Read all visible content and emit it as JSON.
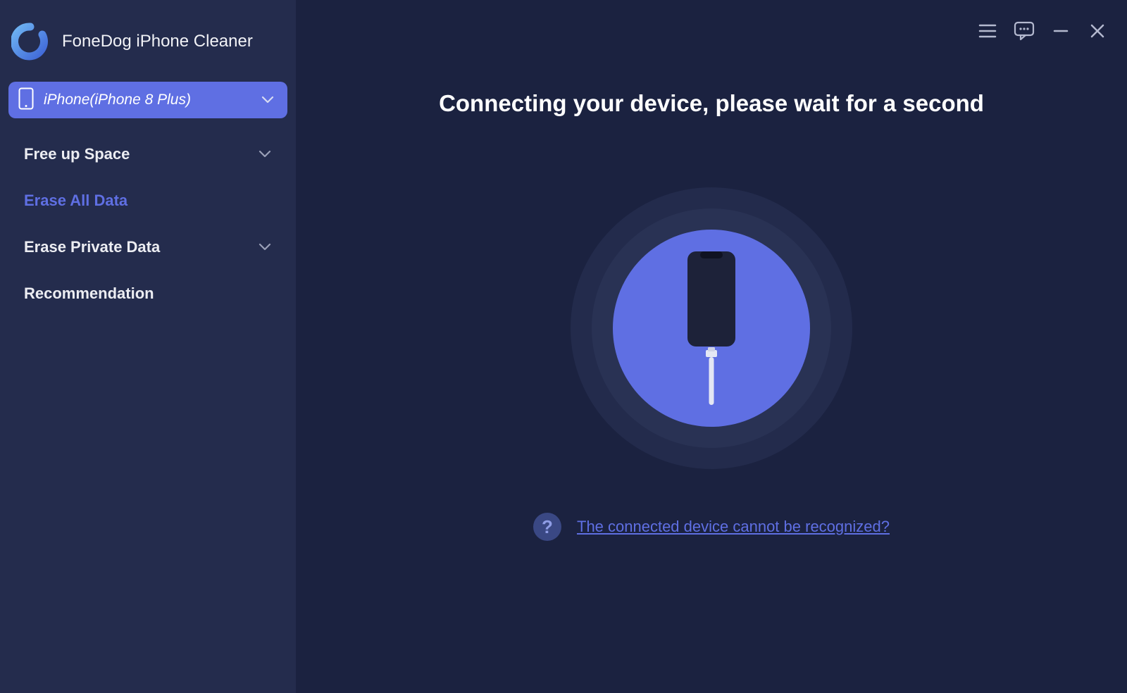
{
  "app": {
    "title": "FoneDog iPhone Cleaner"
  },
  "device": {
    "label": "iPhone(iPhone 8 Plus)"
  },
  "nav": {
    "free_up_space": "Free up Space",
    "erase_all_data": "Erase All Data",
    "erase_private_data": "Erase Private Data",
    "recommendation": "Recommendation"
  },
  "main": {
    "headline": "Connecting your device, please wait for a second",
    "help_icon": "?",
    "help_link": "The connected device cannot be recognized?"
  },
  "icons": {
    "menu": "menu-icon",
    "feedback": "feedback-icon",
    "minimize": "minimize-icon",
    "close": "close-icon"
  }
}
